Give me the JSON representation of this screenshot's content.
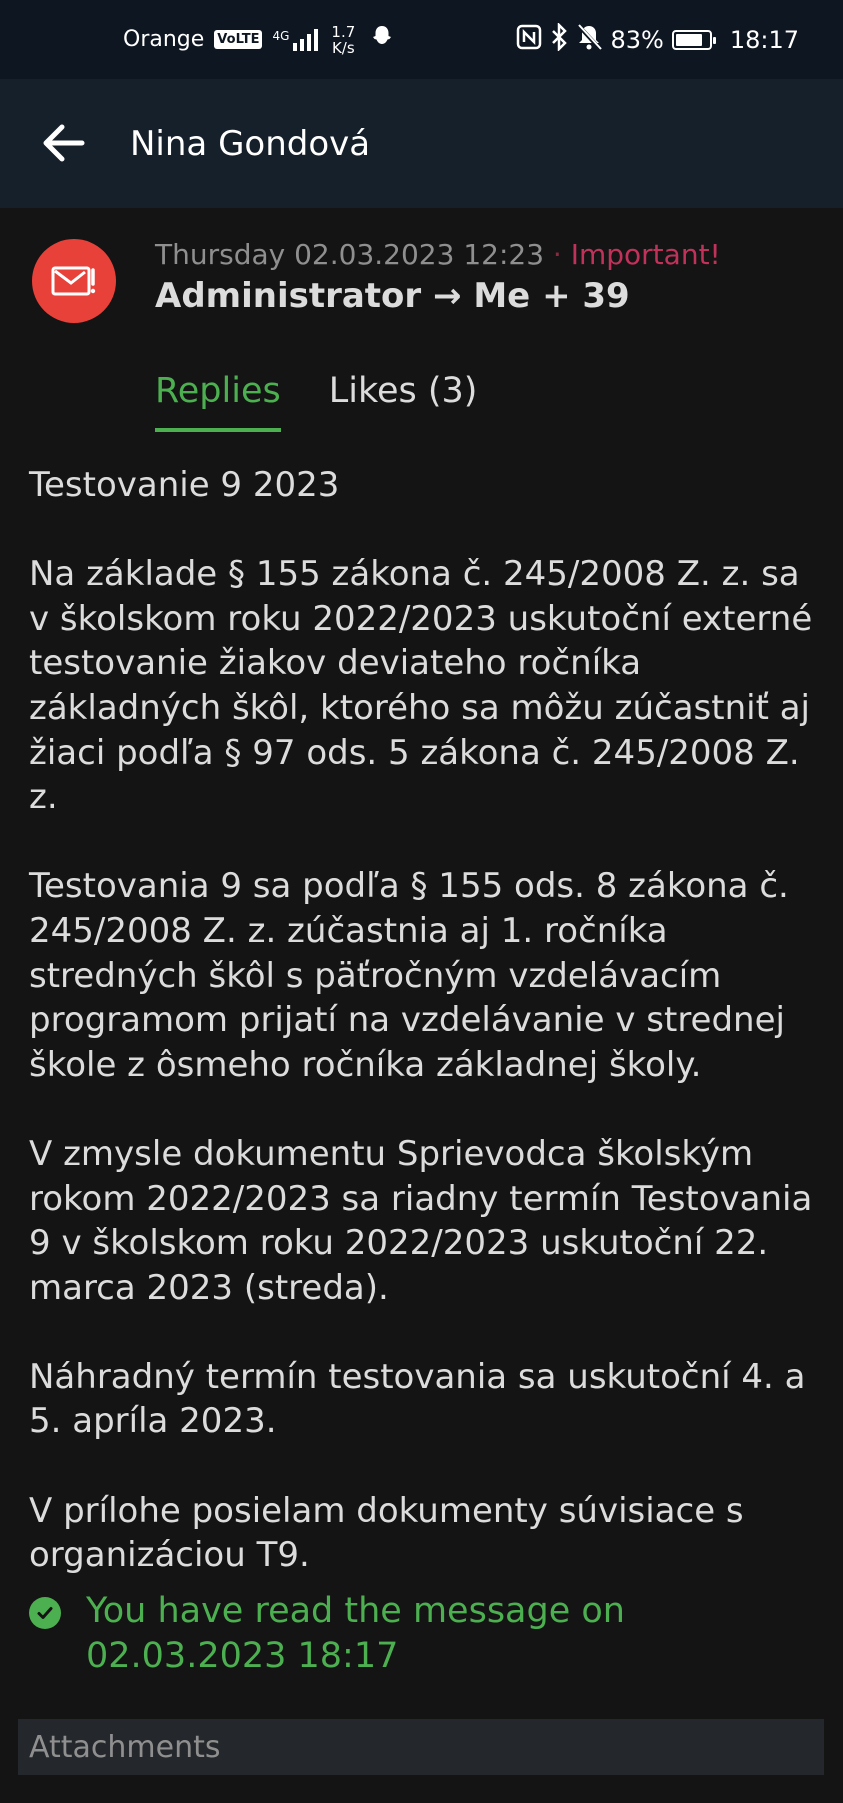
{
  "status_bar": {
    "carrier": "Orange",
    "volte": "VoLTE",
    "network": "4G",
    "speed_value": "1.7",
    "speed_unit": "K/s",
    "battery": "83%",
    "battery_level": 0.83,
    "time": "18:17"
  },
  "app_bar": {
    "title": "Nina Gondová"
  },
  "message": {
    "date": "Thursday 02.03.2023 12:23",
    "separator": "·",
    "flag": "Important!",
    "sender": "Administrator → Me + 39"
  },
  "tabs": [
    {
      "label": "Replies",
      "active": true
    },
    {
      "label": "Likes (3)",
      "active": false
    }
  ],
  "body": {
    "paragraphs": [
      "Testovanie 9 2023",
      "Na základe § 155 zákona č. 245/2008 Z. z. sa v školskom roku 2022/2023 uskutoční externé testovanie žiakov deviateho ročníka základných škôl, ktorého sa môžu zúčastniť aj žiaci podľa § 97 ods. 5 zákona č. 245/2008 Z. z.",
      "Testovania 9 sa podľa § 155 ods. 8 zákona č. 245/2008 Z. z. zúčastnia aj 1. ročníka stredných škôl s päťročným vzdelávacím programom prijatí na vzdelávanie v strednej škole z ôsmeho ročníka základnej školy.",
      "V zmysle dokumentu Sprievodca školským rokom 2022/2023 sa riadny termín Testovania 9 v školskom roku 2022/2023 uskutoční 22. marca 2023 (streda).",
      "Náhradný termín testovania sa uskutoční 4. a 5. apríla 2023.",
      "V prílohe posielam dokumenty súvisiace s organizáciou T9."
    ]
  },
  "read_receipt": "You have read the message on 02.03.2023 18:17",
  "attachments_label": "Attachments",
  "colors": {
    "accent_green": "#4caf50",
    "important_red": "#c0325a",
    "avatar_red": "#e8413a",
    "background": "#141414",
    "app_bar": "#16202b"
  },
  "icons": {
    "back": "arrow-left-icon",
    "avatar": "envelope-alert-icon",
    "read": "check-circle-icon"
  }
}
